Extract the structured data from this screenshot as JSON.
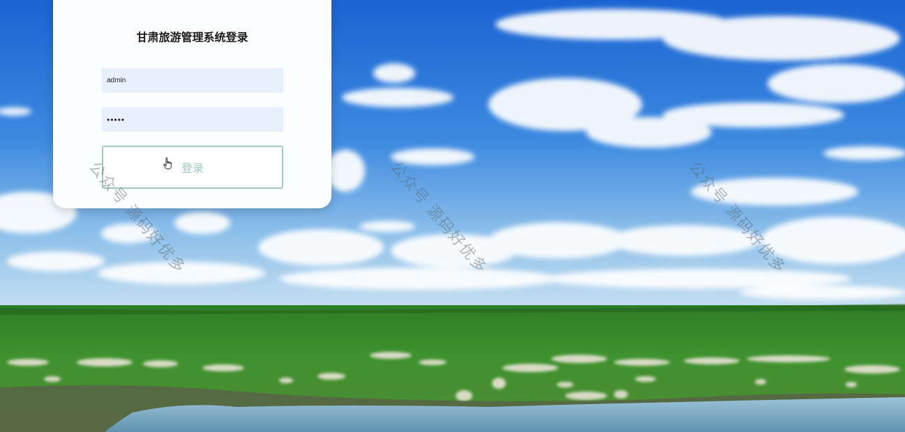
{
  "login": {
    "title": "甘肃旅游管理系统登录",
    "username_value": "admin",
    "password_value": "•••••",
    "submit_label": "登录"
  },
  "watermark": {
    "text": "公众号 源码好优多"
  },
  "colors": {
    "sky_top": "#1e6fd9",
    "sky_bottom": "#8fbfe8",
    "grass": "#3f8a2e",
    "water": "#6fa3bd",
    "field_bg": "#e8f0fe",
    "button_border": "#9ec9c0"
  }
}
